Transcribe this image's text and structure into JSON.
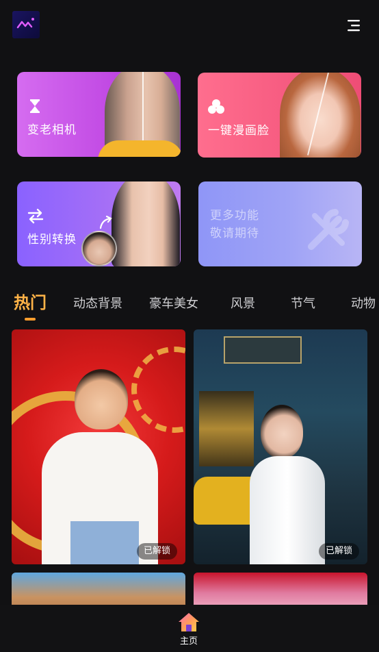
{
  "header": {
    "logo_icon": "brand-logo-icon",
    "menu_icon": "menu-icon"
  },
  "features": [
    {
      "label": "变老相机",
      "icon": "hourglass-icon"
    },
    {
      "label": "一键漫画脸",
      "icon": "cluster-icon"
    },
    {
      "label": "性别转换",
      "icon": "swap-arrows-icon"
    },
    {
      "line1": "更多功能",
      "line2": "敬请期待"
    }
  ],
  "tabs": [
    {
      "label": "热门",
      "active": true
    },
    {
      "label": "动态背景"
    },
    {
      "label": "豪车美女"
    },
    {
      "label": "风景"
    },
    {
      "label": "节气"
    },
    {
      "label": "动物"
    }
  ],
  "templates": [
    {
      "badge": "已解锁"
    },
    {
      "badge": "已解锁"
    }
  ],
  "bottom_nav": {
    "home_label": "主页",
    "home_icon": "home-icon"
  },
  "colors": {
    "accent": "#ffb347",
    "background": "#111113"
  }
}
